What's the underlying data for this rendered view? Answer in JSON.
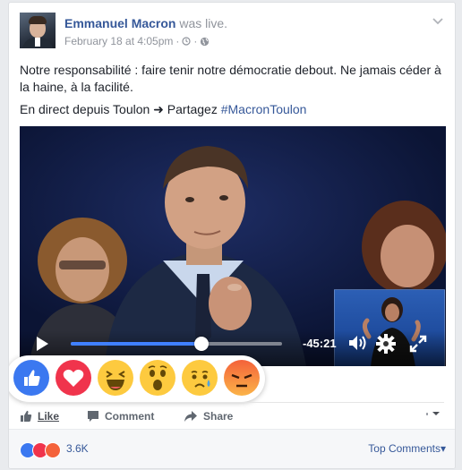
{
  "post": {
    "author": "Emmanuel Macron",
    "action": "was live.",
    "date": "February 18 at 4:05pm",
    "meta_sep": "·",
    "text_line1": "Notre responsabilité : faire tenir notre démocratie debout. Ne jamais céder à la haine, à la facilité.",
    "text_line2_prefix": "En direct depuis Toulon ➜ Partagez ",
    "hashtag": "#MacronToulon"
  },
  "video": {
    "progress": 0.62,
    "time_remaining": "-45:21",
    "accent_color": "#4080ff"
  },
  "reactions": [
    "like",
    "love",
    "haha",
    "wow",
    "sad",
    "angry"
  ],
  "actions": {
    "like": "Like",
    "comment": "Comment",
    "share": "Share"
  },
  "summary": {
    "count": "3.6K",
    "top_comments": "Top Comments"
  },
  "colors": {
    "link": "#365899",
    "like_blue": "#3b78f0",
    "love_red": "#f0344c",
    "emoji_yellow": "#fdca3f",
    "angry_orange": "#f4623a"
  }
}
